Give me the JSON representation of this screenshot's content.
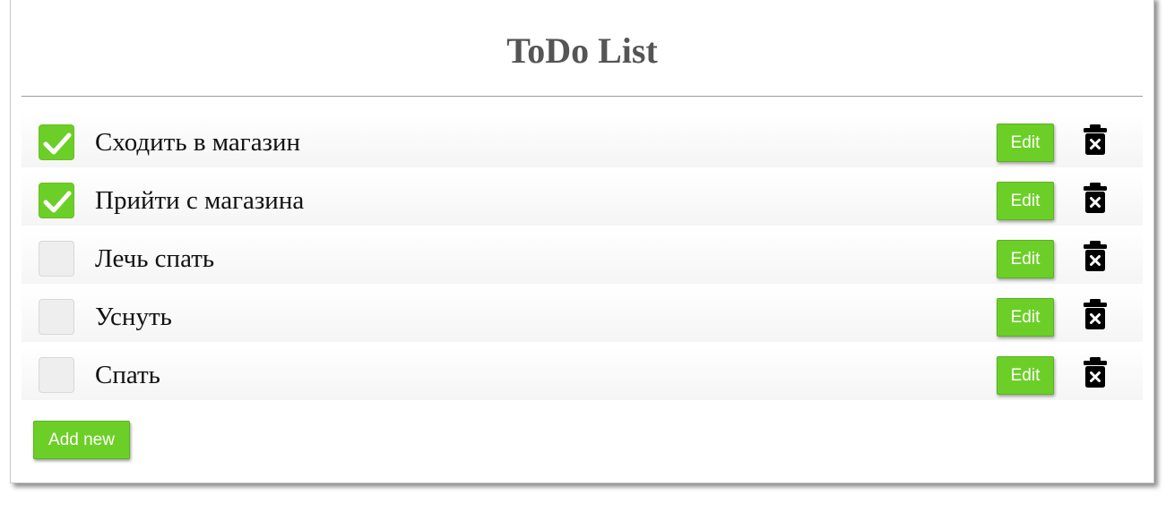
{
  "title": "ToDo List",
  "todos": [
    {
      "text": "Сходить в магазин",
      "checked": true,
      "edit_label": "Edit",
      "delete_icon": "trash-x-icon"
    },
    {
      "text": "Прийти с магазина",
      "checked": true,
      "edit_label": "Edit",
      "delete_icon": "trash-x-icon"
    },
    {
      "text": "Лечь спать",
      "checked": false,
      "edit_label": "Edit",
      "delete_icon": "trash-x-icon"
    },
    {
      "text": "Уснуть",
      "checked": false,
      "edit_label": "Edit",
      "delete_icon": "trash-x-icon"
    },
    {
      "text": "Спать",
      "checked": false,
      "edit_label": "Edit",
      "delete_icon": "trash-x-icon"
    }
  ],
  "add_button_label": "Add new",
  "colors": {
    "accent": "#6ccf27",
    "title": "#555555",
    "checkbox_unchecked": "#eeeeee"
  }
}
